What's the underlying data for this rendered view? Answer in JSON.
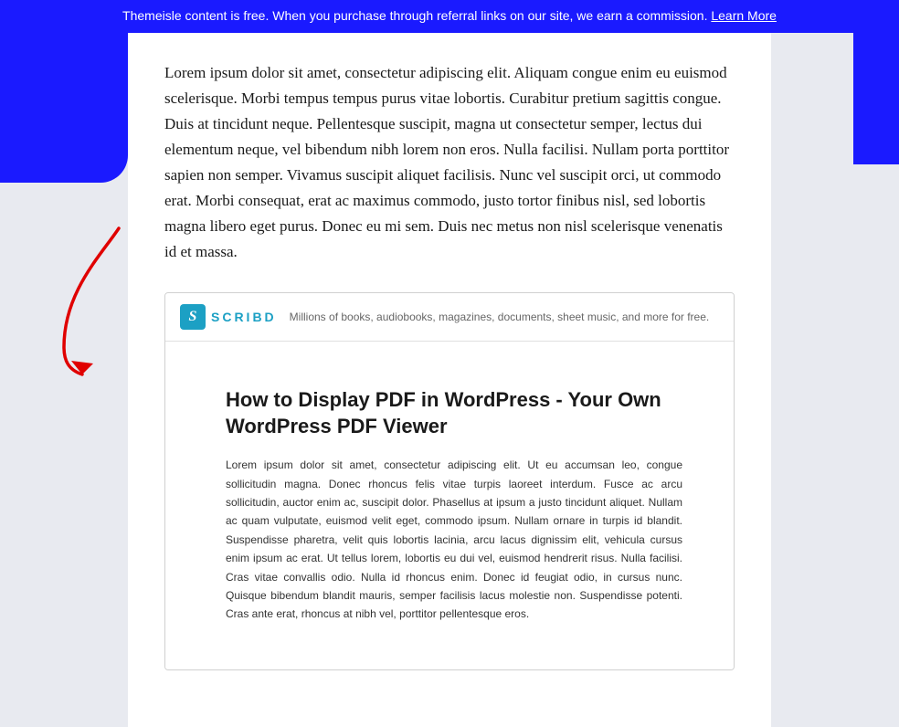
{
  "notification": {
    "text": "Themeisle content is free. When you purchase through referral links on our site, we earn a commission.",
    "link_text": "Learn More"
  },
  "main_body": {
    "paragraph": "Lorem ipsum dolor sit amet, consectetur adipiscing elit. Aliquam congue enim eu euismod scelerisque. Morbi tempus tempus purus vitae lobortis. Curabitur pretium sagittis congue. Duis at tincidunt neque. Pellentesque suscipit, magna ut consectetur semper, lectus dui elementum neque, vel bibendum nibh lorem non eros. Nulla facilisi. Nullam porta porttitor sapien non semper. Vivamus suscipit aliquet facilisis. Nunc vel suscipit orci, ut commodo erat. Morbi consequat, erat ac maximus commodo, justo tortor finibus nisl, sed lobortis magna libero eget purus. Donec eu mi sem. Duis nec metus non nisl scelerisque venenatis id et massa."
  },
  "scribd": {
    "icon_letter": "S",
    "name": "SCRIBD",
    "tagline": "Millions of books, audiobooks, magazines, documents, sheet music, and more for free.",
    "document": {
      "title": "How to Display PDF in WordPress - Your Own WordPress PDF Viewer",
      "body": "Lorem ipsum dolor sit amet, consectetur adipiscing elit. Ut eu accumsan leo, congue sollicitudin magna. Donec rhoncus felis vitae turpis laoreet interdum. Fusce ac arcu sollicitudin, auctor enim ac, suscipit dolor. Phasellus at ipsum a justo tincidunt aliquet. Nullam ac quam vulputate, euismod velit eget, commodo ipsum. Nullam ornare in turpis id blandit. Suspendisse pharetra, velit quis lobortis lacinia, arcu lacus dignissim elit, vehicula cursus enim ipsum ac erat. Ut tellus lorem, lobortis eu dui vel, euismod hendrerit risus. Nulla facilisi. Cras vitae convallis odio. Nulla id rhoncus enim. Donec id feugiat odio, in cursus nunc. Quisque bibendum blandit mauris, semper facilisis lacus molestie non. Suspendisse potenti. Cras ante erat, rhoncus at nibh vel, porttitor pellentesque eros."
    }
  }
}
